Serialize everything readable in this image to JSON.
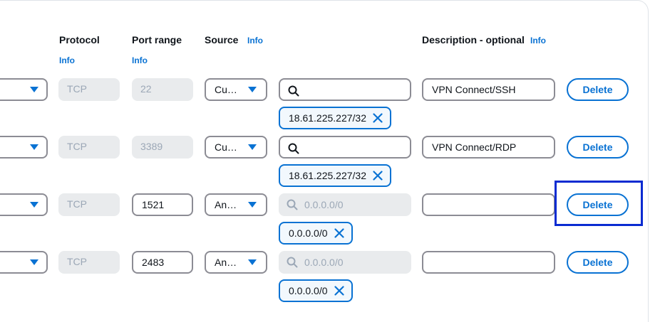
{
  "headers": {
    "protocol": "Protocol",
    "protocol_info": "Info",
    "port_range": "Port range",
    "port_range_info": "Info",
    "source": "Source",
    "source_info": "Info",
    "description": "Description - optional",
    "description_info": "Info"
  },
  "rows": [
    {
      "protocol": "TCP",
      "port": "22",
      "source": "Cu…",
      "search_placeholder": "",
      "token": "18.61.225.227/32",
      "description": "VPN Connect/SSH",
      "delete_label": "Delete"
    },
    {
      "protocol": "TCP",
      "port": "3389",
      "source": "Cu…",
      "search_placeholder": "",
      "token": "18.61.225.227/32",
      "description": "VPN Connect/RDP",
      "delete_label": "Delete"
    },
    {
      "protocol": "TCP",
      "port": "1521",
      "source": "An…",
      "search_placeholder": "0.0.0.0/0",
      "token": "0.0.0.0/0",
      "description": "",
      "delete_label": "Delete"
    },
    {
      "protocol": "TCP",
      "port": "2483",
      "source": "An…",
      "search_placeholder": "0.0.0.0/0",
      "token": "0.0.0.0/0",
      "description": "",
      "delete_label": "Delete"
    }
  ],
  "icons": {
    "dropdown": "caret-down-icon",
    "search": "search-icon",
    "remove": "close-icon"
  },
  "colors": {
    "accent": "#0972d3",
    "focus_ring": "#0a2bd1",
    "disabled_bg": "#e9ebed",
    "disabled_text": "#9ba7b6",
    "border": "#8c8c94"
  }
}
